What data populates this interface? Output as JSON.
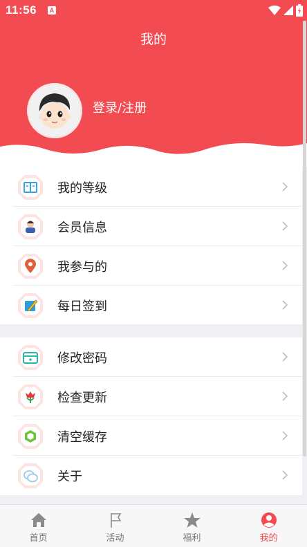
{
  "status_bar": {
    "time": "11:56",
    "badge": "A"
  },
  "header": {
    "title": "我的",
    "login_label": "登录/注册"
  },
  "group1": [
    {
      "label": "我的等级",
      "icon": "level-book-icon"
    },
    {
      "label": "会员信息",
      "icon": "member-person-icon"
    },
    {
      "label": "我参与的",
      "icon": "location-pin-icon"
    },
    {
      "label": "每日签到",
      "icon": "checkin-pencil-icon"
    }
  ],
  "group2": [
    {
      "label": "修改密码",
      "icon": "password-card-icon"
    },
    {
      "label": "检查更新",
      "icon": "update-flower-icon"
    },
    {
      "label": "清空缓存",
      "icon": "cache-hexagon-icon"
    },
    {
      "label": "关于",
      "icon": "about-chat-icon"
    }
  ],
  "tabs": [
    {
      "label": "首页",
      "icon": "home-icon",
      "active": false
    },
    {
      "label": "活动",
      "icon": "flag-icon",
      "active": false
    },
    {
      "label": "福利",
      "icon": "star-icon",
      "active": false
    },
    {
      "label": "我的",
      "icon": "user-icon",
      "active": true
    }
  ],
  "colors": {
    "accent": "#f24b52",
    "background": "#efeff4"
  }
}
